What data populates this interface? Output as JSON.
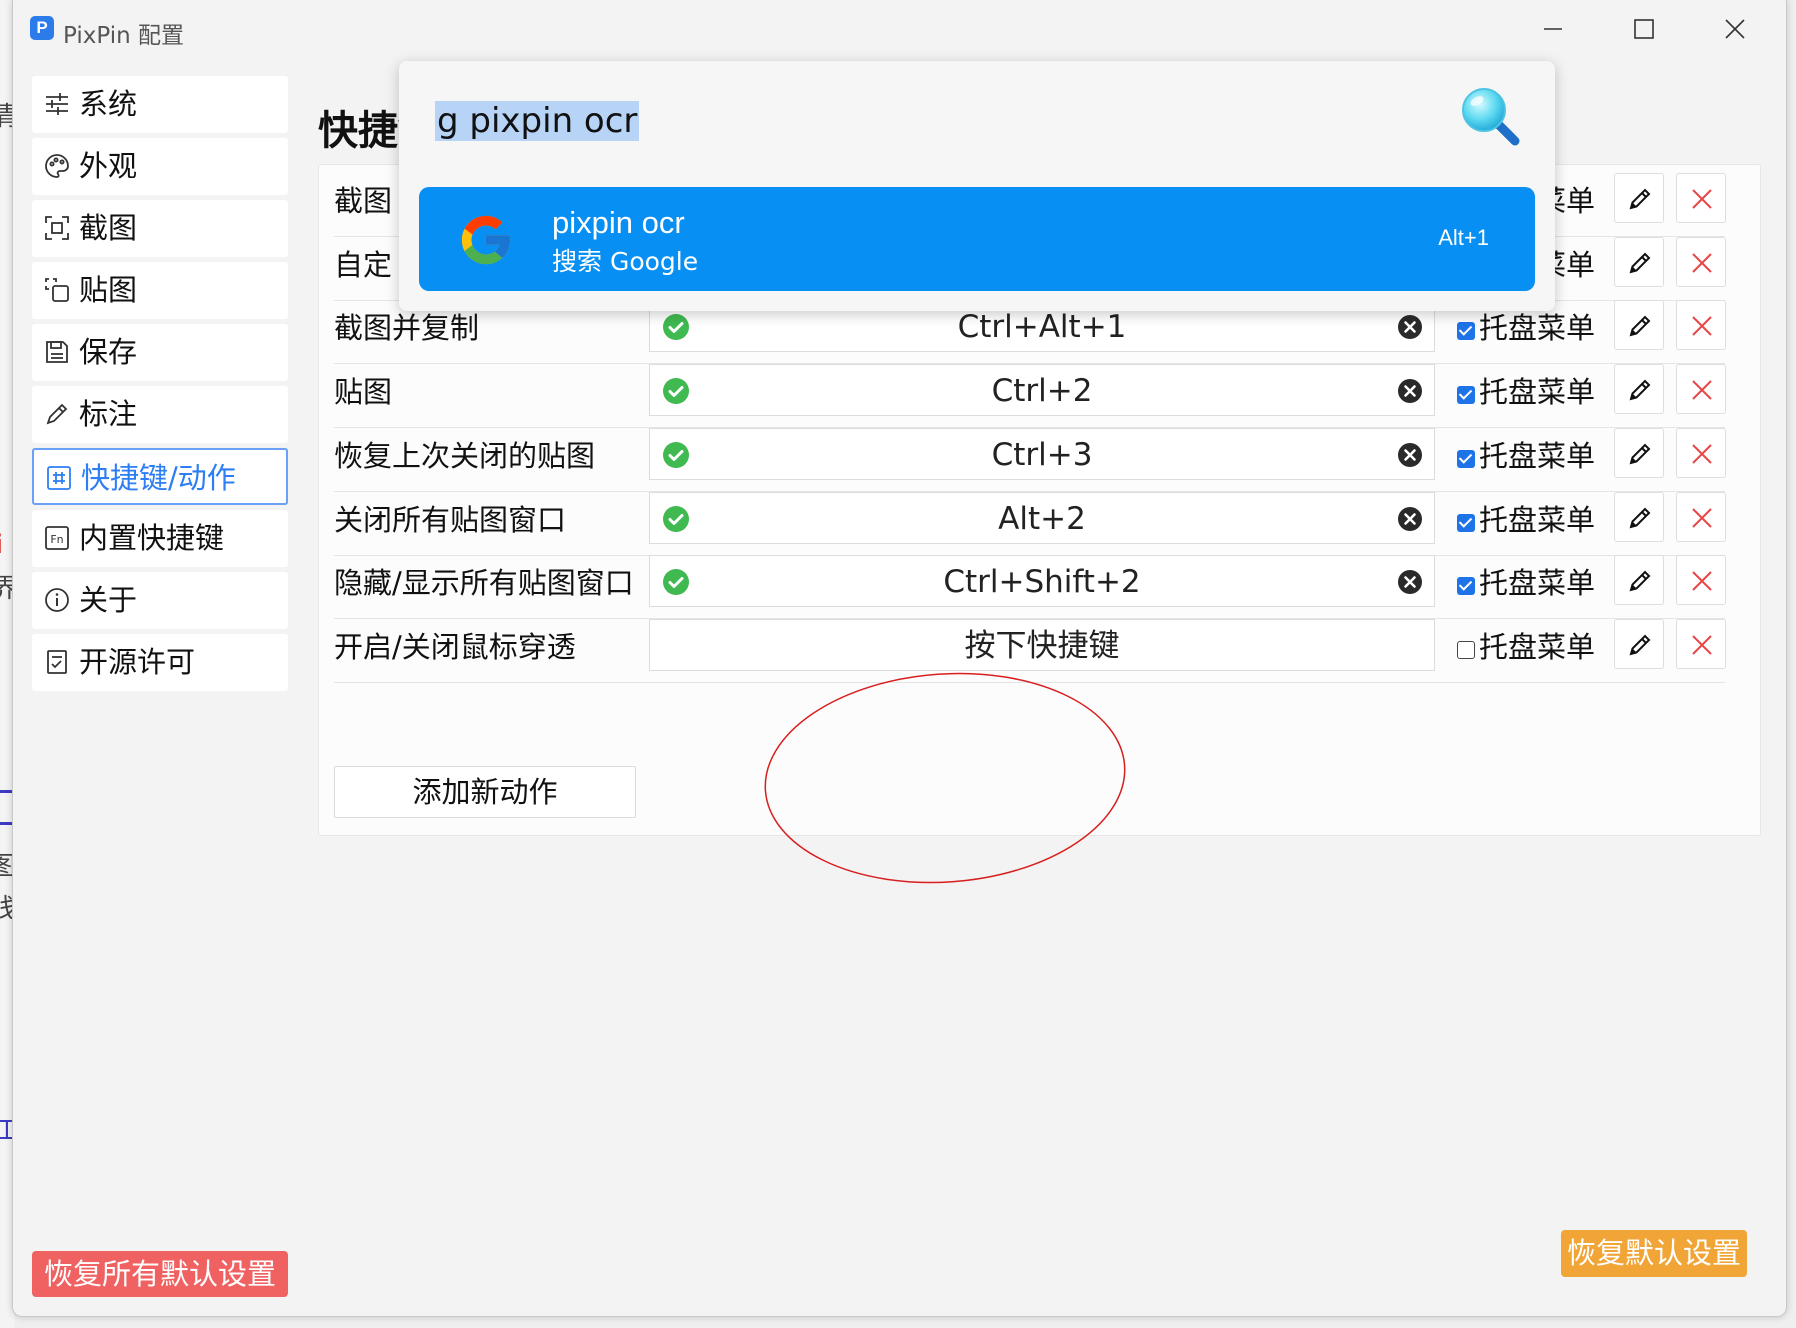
{
  "window": {
    "title": "PixPin 配置"
  },
  "sidebar": {
    "items": [
      {
        "label": "系统",
        "icon": "sliders-icon"
      },
      {
        "label": "外观",
        "icon": "palette-icon"
      },
      {
        "label": "截图",
        "icon": "screenshot-icon"
      },
      {
        "label": "贴图",
        "icon": "pin-icon"
      },
      {
        "label": "保存",
        "icon": "save-icon"
      },
      {
        "label": "标注",
        "icon": "pencil-icon"
      },
      {
        "label": "快捷键/动作",
        "icon": "hotkey-icon",
        "active": true
      },
      {
        "label": "内置快捷键",
        "icon": "fn-key-icon"
      },
      {
        "label": "关于",
        "icon": "info-icon"
      },
      {
        "label": "开源许可",
        "icon": "license-icon"
      }
    ]
  },
  "main": {
    "heading": "快捷键/动作",
    "tray_label": "托盘菜单",
    "add_button": "添加新动作",
    "rows": [
      {
        "name": "截图",
        "hotkey": "",
        "set": true,
        "tray": true
      },
      {
        "name": "自定",
        "hotkey": "",
        "set": true,
        "tray": true
      },
      {
        "name": "截图并复制",
        "hotkey": "Ctrl+Alt+1",
        "set": true,
        "tray": true
      },
      {
        "name": "贴图",
        "hotkey": "Ctrl+2",
        "set": true,
        "tray": true
      },
      {
        "name": "恢复上次关闭的贴图",
        "hotkey": "Ctrl+3",
        "set": true,
        "tray": true
      },
      {
        "name": "关闭所有贴图窗口",
        "hotkey": "Alt+2",
        "set": true,
        "tray": true
      },
      {
        "name": "隐藏/显示所有贴图窗口",
        "hotkey": "Ctrl+Shift+2",
        "set": true,
        "tray": true
      },
      {
        "name": "开启/关闭鼠标穿透",
        "hotkey": "按下快捷键",
        "set": false,
        "tray": false
      }
    ]
  },
  "footer": {
    "reset_all": "恢复所有默认设置",
    "reset_default": "恢复默认设置"
  },
  "launcher": {
    "query": "g pixpin ocr",
    "result": {
      "title": "pixpin ocr",
      "subtitle": "搜索 Google",
      "shortcut": "Alt+1",
      "icon": "google-icon"
    }
  },
  "colors": {
    "accent": "#2d7ef5",
    "result_bg": "#088ff4",
    "ok_green": "#3fb950",
    "delete_red": "#e84545",
    "reset_all_bg": "#f06262",
    "reset_default_bg": "#f0a536",
    "annotation": "#d81e1e"
  }
}
